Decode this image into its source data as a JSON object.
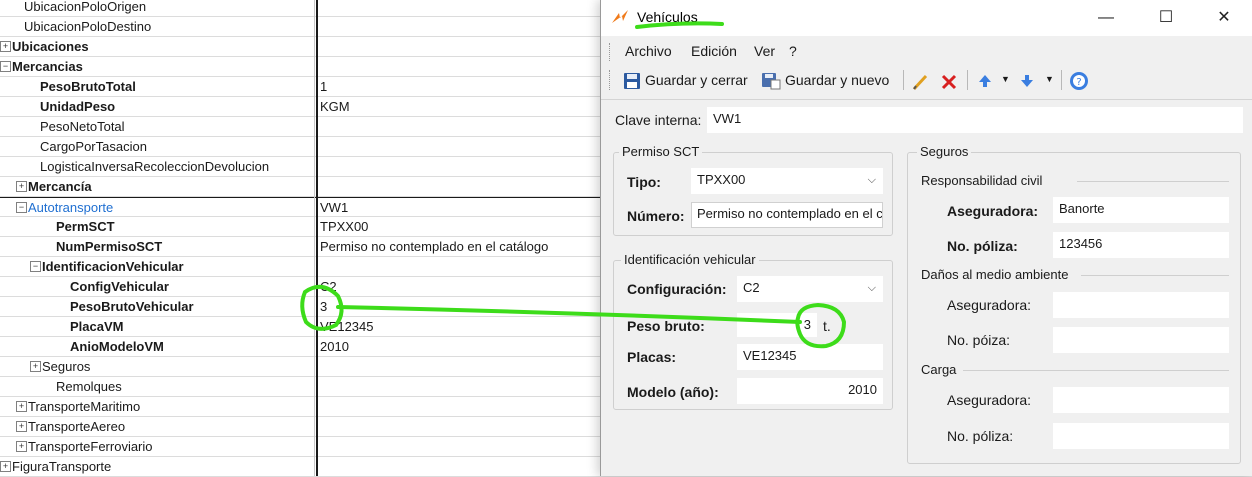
{
  "tree": {
    "rows": [
      {
        "label": "UbicacionPoloOrigen",
        "value": "",
        "expander": "",
        "style": "normal"
      },
      {
        "label": "UbicacionPoloDestino",
        "value": "",
        "expander": "",
        "style": "normal"
      },
      {
        "label": "Ubicaciones",
        "value": "",
        "expander": "+",
        "style": "bold"
      },
      {
        "label": "Mercancias",
        "value": "",
        "expander": "−",
        "style": "bold"
      },
      {
        "label": "PesoBrutoTotal",
        "value": "1",
        "expander": "",
        "style": "bold"
      },
      {
        "label": "UnidadPeso",
        "value": "KGM",
        "expander": "",
        "style": "bold"
      },
      {
        "label": "PesoNetoTotal",
        "value": "",
        "expander": "",
        "style": "normal"
      },
      {
        "label": "CargoPorTasacion",
        "value": "",
        "expander": "",
        "style": "normal"
      },
      {
        "label": "LogisticaInversaRecoleccionDevolucion",
        "value": "",
        "expander": "",
        "style": "normal"
      },
      {
        "label": "Mercancía",
        "value": "",
        "expander": "+",
        "style": "bold"
      },
      {
        "label": "Autotransporte",
        "value": "VW1",
        "expander": "−",
        "style": "blue"
      },
      {
        "label": "PermSCT",
        "value": "TPXX00",
        "expander": "",
        "style": "bold"
      },
      {
        "label": "NumPermisoSCT",
        "value": "Permiso no contemplado en el catálogo",
        "expander": "",
        "style": "bold"
      },
      {
        "label": "IdentificacionVehicular",
        "value": "",
        "expander": "−",
        "style": "bold"
      },
      {
        "label": "ConfigVehicular",
        "value": "C2",
        "expander": "",
        "style": "bold"
      },
      {
        "label": "PesoBrutoVehicular",
        "value": "3",
        "expander": "",
        "style": "bold"
      },
      {
        "label": "PlacaVM",
        "value": "VE12345",
        "expander": "",
        "style": "bold"
      },
      {
        "label": "AnioModeloVM",
        "value": "2010",
        "expander": "",
        "style": "bold"
      },
      {
        "label": "Seguros",
        "value": "",
        "expander": "+",
        "style": "normal"
      },
      {
        "label": "Remolques",
        "value": "",
        "expander": "",
        "style": "normal"
      },
      {
        "label": "TransporteMaritimo",
        "value": "",
        "expander": "+",
        "style": "normal"
      },
      {
        "label": "TransporteAereo",
        "value": "",
        "expander": "+",
        "style": "normal"
      },
      {
        "label": "TransporteFerroviario",
        "value": "",
        "expander": "+",
        "style": "normal"
      },
      {
        "label": "FiguraTransporte",
        "value": "",
        "expander": "+",
        "style": "normal"
      }
    ]
  },
  "dialog": {
    "title": "Vehículos",
    "window_controls": {
      "minimize": "—",
      "maximize": "☐",
      "close": "✕"
    },
    "menu": [
      "Archivo",
      "Edición",
      "Ver",
      "?"
    ],
    "toolbar": {
      "save_close": "Guardar y cerrar",
      "save_new": "Guardar y nuevo"
    },
    "clave": {
      "label": "Clave interna:",
      "value": "VW1"
    },
    "permiso": {
      "group": "Permiso SCT",
      "tipo_label": "Tipo:",
      "tipo_value": "TPXX00",
      "numero_label": "Número:",
      "numero_value": "Permiso no contemplado en el c"
    },
    "identificacion": {
      "group": "Identificación vehicular",
      "config_label": "Configuración:",
      "config_value": "C2",
      "peso_label": "Peso bruto:",
      "peso_value": "3",
      "peso_unit": "t.",
      "placas_label": "Placas:",
      "placas_value": "VE12345",
      "modelo_label": "Modelo (año):",
      "modelo_value": "2010"
    },
    "seguros": {
      "group": "Seguros",
      "resp_title": "Responsabilidad civil",
      "resp_aseg_label": "Aseguradora:",
      "resp_aseg_value": "Banorte",
      "resp_poliza_label": "No. póliza:",
      "resp_poliza_value": "123456",
      "danos_title": "Daños al medio ambiente",
      "danos_aseg_label": "Aseguradora:",
      "danos_aseg_value": "",
      "danos_poliza_label": "No. póiza:",
      "danos_poliza_value": "",
      "carga_title": "Carga",
      "carga_aseg_label": "Aseguradora:",
      "carga_aseg_value": "",
      "carga_poliza_label": "No. póliza:",
      "carga_poliza_value": ""
    }
  },
  "colors": {
    "annotation": "#3ddc1a",
    "accent": "#1f6fd1",
    "app_icon": "#f07a1a"
  }
}
